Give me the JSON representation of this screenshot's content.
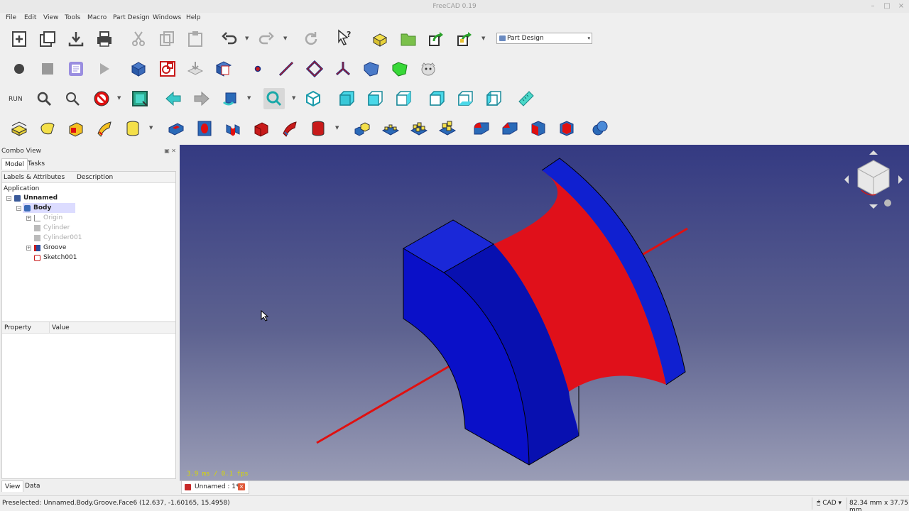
{
  "window": {
    "title": "FreeCAD 0.19"
  },
  "menu": [
    "File",
    "Edit",
    "View",
    "Tools",
    "Macro",
    "Part Design",
    "Windows",
    "Help"
  ],
  "toolbar": {
    "workbench": "Part Design",
    "run_label": "RUN"
  },
  "combo_view": {
    "title": "Combo View",
    "tabs": [
      "Model",
      "Tasks"
    ],
    "tree_columns": [
      "Labels & Attributes",
      "Description"
    ],
    "section": "Application",
    "tree": [
      {
        "label": "Unnamed",
        "bold": true
      },
      {
        "label": "Body",
        "bold": true
      },
      {
        "label": "Origin"
      },
      {
        "label": "Cylinder"
      },
      {
        "label": "Cylinder001"
      },
      {
        "label": "Groove"
      },
      {
        "label": "Sketch001"
      }
    ],
    "property_columns": [
      "Property",
      "Value"
    ],
    "bottom_tabs": [
      "View",
      "Data"
    ]
  },
  "viewport": {
    "fps": "3.9 ms / 0.1 fps"
  },
  "document_tab": {
    "label": "Unnamed : 1*"
  },
  "status": {
    "message": "Preselected: Unnamed.Body.Groove.Face6 (12.637, -1.60165, 15.4958)",
    "navigation": "CAD",
    "dimensions": "82.34 mm x 37.75 mm"
  },
  "colors": {
    "blue_solid": "#0a10c8",
    "red_face": "#e0101a",
    "axis_red": "#e01010",
    "viewport_top": "#343a82",
    "viewport_bottom": "#9a9db6"
  }
}
